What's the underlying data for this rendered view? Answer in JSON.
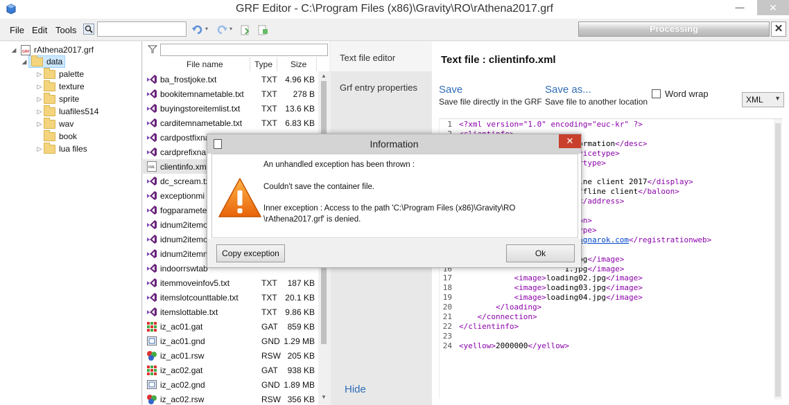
{
  "window": {
    "title": "GRF Editor - C:\\Program Files (x86)\\Gravity\\RO\\rAthena2017.grf",
    "min_glyph": "—",
    "max_glyph": "☐",
    "close_glyph": "✕"
  },
  "menu": {
    "items": [
      "File",
      "Edit",
      "Tools"
    ]
  },
  "search": {
    "value": ""
  },
  "progress": {
    "label": "Processing",
    "close_glyph": "✕"
  },
  "tree": {
    "root": "rAthena2017.grf",
    "selected": "data",
    "children": [
      "palette",
      "texture",
      "sprite",
      "luafiles514",
      "wav",
      "book",
      "lua files"
    ]
  },
  "file_list": {
    "filter_value": "",
    "headers": {
      "name": "File name",
      "type": "Type",
      "size": "Size"
    },
    "rows": [
      {
        "name": "ba_frostjoke.txt",
        "type": "TXT",
        "size": "4.96 KB",
        "icon": "vs-file-icon"
      },
      {
        "name": "bookitemnametable.txt",
        "type": "TXT",
        "size": "278 B",
        "icon": "vs-file-icon"
      },
      {
        "name": "buyingstoreitemlist.txt",
        "type": "TXT",
        "size": "13.6 KB",
        "icon": "vs-file-icon"
      },
      {
        "name": "carditemnametable.txt",
        "type": "TXT",
        "size": "6.83 KB",
        "icon": "vs-file-icon"
      },
      {
        "name": "cardpostfixna",
        "type": "",
        "size": "",
        "icon": "vs-file-icon"
      },
      {
        "name": "cardprefixna",
        "type": "",
        "size": "",
        "icon": "vs-file-icon"
      },
      {
        "name": "clientinfo.xm",
        "type": "",
        "size": "",
        "icon": "xml-file-icon"
      },
      {
        "name": "dc_scream.tx",
        "type": "",
        "size": "",
        "icon": "vs-file-icon"
      },
      {
        "name": "exceptionmi",
        "type": "",
        "size": "",
        "icon": "vs-file-icon"
      },
      {
        "name": "fogparamete",
        "type": "",
        "size": "",
        "icon": "vs-file-icon"
      },
      {
        "name": "idnum2itemo",
        "type": "",
        "size": "",
        "icon": "vs-file-icon"
      },
      {
        "name": "idnum2itemo",
        "type": "",
        "size": "",
        "icon": "vs-file-icon"
      },
      {
        "name": "idnum2itemn",
        "type": "",
        "size": "",
        "icon": "vs-file-icon"
      },
      {
        "name": "indoorrswtab",
        "type": "",
        "size": "",
        "icon": "vs-file-icon"
      },
      {
        "name": "itemmoveinfov5.txt",
        "type": "TXT",
        "size": "187 KB",
        "icon": "vs-file-icon"
      },
      {
        "name": "itemslotcounttable.txt",
        "type": "TXT",
        "size": "20.1 KB",
        "icon": "vs-file-icon"
      },
      {
        "name": "itemslottable.txt",
        "type": "TXT",
        "size": "9.86 KB",
        "icon": "vs-file-icon"
      },
      {
        "name": "iz_ac01.gat",
        "type": "GAT",
        "size": "859 KB",
        "icon": "gat-file-icon"
      },
      {
        "name": "iz_ac01.gnd",
        "type": "GND",
        "size": "1.29 MB",
        "icon": "gnd-file-icon"
      },
      {
        "name": "iz_ac01.rsw",
        "type": "RSW",
        "size": "205 KB",
        "icon": "rsw-file-icon"
      },
      {
        "name": "iz_ac02.gat",
        "type": "GAT",
        "size": "938 KB",
        "icon": "gat-file-icon"
      },
      {
        "name": "iz_ac02.gnd",
        "type": "GND",
        "size": "1.89 MB",
        "icon": "gnd-file-icon"
      },
      {
        "name": "iz_ac02.rsw",
        "type": "RSW",
        "size": "356 KB",
        "icon": "rsw-file-icon"
      }
    ]
  },
  "side_tabs": {
    "text_editor": "Text file editor",
    "grf_props": "Grf entry properties",
    "hide": "Hide"
  },
  "editor": {
    "title": "Text file : clientinfo.xml",
    "save": {
      "label": "Save",
      "sub": "Save file directly in the GRF"
    },
    "save_as": {
      "label": "Save as...",
      "sub": "Save file to another location"
    },
    "word_wrap": "Word wrap",
    "language": "XML",
    "code_lines": [
      {
        "n": "1",
        "parts": [
          [
            "tag",
            "<?xml version=\"1.0\" encoding=\"euc-kr\" ?>"
          ]
        ]
      },
      {
        "n": "2",
        "parts": [
          [
            "tag",
            "<clientinfo>"
          ]
        ]
      },
      {
        "n": "3",
        "parts": [
          [
            "txt",
            "                       information"
          ],
          [
            "tag",
            "</desc>"
          ]
        ]
      },
      {
        "n": "4",
        "parts": [
          [
            "tag",
            "                       servicetype>"
          ]
        ]
      },
      {
        "n": "5",
        "parts": [
          [
            "tag",
            "                       rvertype>"
          ]
        ]
      },
      {
        "n": "6",
        "parts": []
      },
      {
        "n": "7",
        "parts": [
          [
            "txt",
            "                       ffline client 2017"
          ],
          [
            "tag",
            "</display>"
          ]
        ]
      },
      {
        "n": "8",
        "parts": [
          [
            "txt",
            "                       l offline client"
          ],
          [
            "tag",
            "</baloon>"
          ]
        ]
      },
      {
        "n": "9",
        "parts": [
          [
            "txt",
            "                       0.1"
          ],
          [
            "tag",
            "</address>"
          ]
        ]
      },
      {
        "n": "10",
        "parts": [
          [
            "tag",
            "                       t>"
          ]
        ]
      },
      {
        "n": "11",
        "parts": [
          [
            "tag",
            "                       rsion>"
          ]
        ]
      },
      {
        "n": "12",
        "parts": [
          [
            "tag",
            "                       ngtype>"
          ]
        ]
      },
      {
        "n": "13",
        "parts": [
          [
            "lnk",
            "                       w.ragnarok.com"
          ],
          [
            "tag",
            "</registrationweb>"
          ]
        ]
      },
      {
        "n": "14",
        "parts": []
      },
      {
        "n": "15",
        "parts": [
          [
            "txt",
            "                       0.jpg"
          ],
          [
            "tag",
            "</image>"
          ]
        ]
      },
      {
        "n": "16",
        "parts": [
          [
            "txt",
            "                       1.jpg"
          ],
          [
            "tag",
            "</image>"
          ]
        ]
      },
      {
        "n": "17",
        "parts": [
          [
            "tag",
            "            <image>"
          ],
          [
            "txt",
            "loading02.jpg"
          ],
          [
            "tag",
            "</image>"
          ]
        ]
      },
      {
        "n": "18",
        "parts": [
          [
            "tag",
            "            <image>"
          ],
          [
            "txt",
            "loading03.jpg"
          ],
          [
            "tag",
            "</image>"
          ]
        ]
      },
      {
        "n": "19",
        "parts": [
          [
            "tag",
            "            <image>"
          ],
          [
            "txt",
            "loading04.jpg"
          ],
          [
            "tag",
            "</image>"
          ]
        ]
      },
      {
        "n": "20",
        "parts": [
          [
            "tag",
            "        </loading>"
          ]
        ]
      },
      {
        "n": "21",
        "parts": [
          [
            "tag",
            "    </connection>"
          ]
        ]
      },
      {
        "n": "22",
        "parts": [
          [
            "tag",
            "</clientinfo>"
          ]
        ]
      },
      {
        "n": "23",
        "parts": []
      },
      {
        "n": "24",
        "parts": [
          [
            "tag",
            "<yellow>"
          ],
          [
            "txt",
            "2000000"
          ],
          [
            "tag",
            "</yellow>"
          ]
        ]
      }
    ]
  },
  "dialog": {
    "title": "Information",
    "close_glyph": "✕",
    "line1": "An unhandled exception has been thrown :",
    "line2": "Couldn't save the container file.",
    "line3": "Inner exception : Access to the path 'C:\\Program Files (x86)\\Gravity\\RO",
    "line4": "\\rAthena2017.grf' is denied.",
    "copy_button": "Copy exception",
    "ok_button": "Ok"
  }
}
